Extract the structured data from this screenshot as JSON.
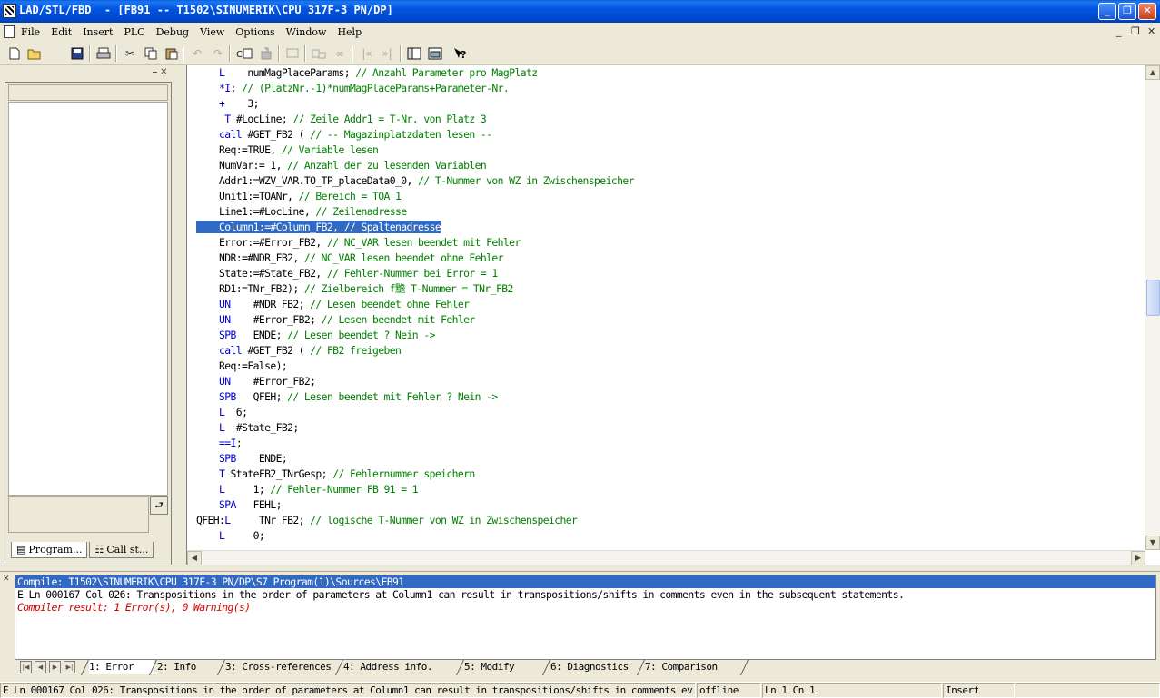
{
  "window": {
    "title": "LAD/STL/FBD  - [FB91 -- T1502\\SINUMERIK\\CPU 317F-3 PN/DP]",
    "controls": {
      "minimize": "_",
      "restore": "❐",
      "close": "✕"
    }
  },
  "menu": {
    "items": [
      "File",
      "Edit",
      "Insert",
      "PLC",
      "Debug",
      "View",
      "Options",
      "Window",
      "Help"
    ],
    "mdi_minimize": "_",
    "mdi_restore": "❐",
    "mdi_close": "✕"
  },
  "toolbar": {
    "icons": [
      "new-icon",
      "open-icon",
      "save-icon",
      "print-icon",
      "cut-icon",
      "copy-icon",
      "paste-icon",
      "undo-icon",
      "redo-icon",
      "compile-icon",
      "download-icon",
      "monitor-icon",
      "breakpoint-icon",
      "step-icon",
      "prev-error-icon",
      "next-error-icon",
      "overview-icon",
      "details-icon",
      "help-context-icon"
    ]
  },
  "left_panel": {
    "tabs": [
      {
        "label": "Program..."
      },
      {
        "label": "Call st..."
      }
    ]
  },
  "editor": {
    "lines": [
      {
        "prefix": "",
        "parts": [
          {
            "t": "    "
          },
          {
            "t": "L",
            "c": "kw"
          },
          {
            "t": "    numMagPlaceParams; "
          },
          {
            "t": "// Anzahl Parameter pro MagPlatz",
            "c": "cm"
          }
        ]
      },
      {
        "prefix": "",
        "parts": [
          {
            "t": "    "
          },
          {
            "t": "*I",
            "c": "kw"
          },
          {
            "t": "; "
          },
          {
            "t": "// (PlatzNr.-1)*numMagPlaceParams+Parameter-Nr.",
            "c": "cm"
          }
        ]
      },
      {
        "prefix": "",
        "parts": [
          {
            "t": "    "
          },
          {
            "t": "+",
            "c": "kw"
          },
          {
            "t": "    3;"
          }
        ]
      },
      {
        "prefix": "",
        "parts": [
          {
            "t": "     "
          },
          {
            "t": "T",
            "c": "kw"
          },
          {
            "t": " #LocLine; "
          },
          {
            "t": "// Zeile Addr1 = T-Nr. von Platz 3",
            "c": "cm"
          }
        ]
      },
      {
        "prefix": "",
        "parts": [
          {
            "t": "    "
          },
          {
            "t": "call",
            "c": "kw"
          },
          {
            "t": " #GET_FB2 ( "
          },
          {
            "t": "// -- Magazinplatzdaten lesen --",
            "c": "cm"
          }
        ]
      },
      {
        "prefix": "",
        "parts": [
          {
            "t": "    Req:=TRUE, "
          },
          {
            "t": "// Variable lesen",
            "c": "cm"
          }
        ]
      },
      {
        "prefix": "",
        "parts": [
          {
            "t": "    NumVar:= 1, "
          },
          {
            "t": "// Anzahl der zu lesenden Variablen",
            "c": "cm"
          }
        ]
      },
      {
        "prefix": "",
        "parts": [
          {
            "t": "    Addr1:=WZV_VAR.TO_TP_placeData0_0, "
          },
          {
            "t": "// T-Nummer von WZ in Zwischenspeicher",
            "c": "cm"
          }
        ]
      },
      {
        "prefix": "",
        "parts": [
          {
            "t": "    Unit1:=TOANr, "
          },
          {
            "t": "// Bereich = TOA 1",
            "c": "cm"
          }
        ]
      },
      {
        "prefix": "",
        "parts": [
          {
            "t": "    Line1:=#LocLine, "
          },
          {
            "t": "// Zeilenadresse",
            "c": "cm"
          }
        ]
      },
      {
        "prefix": "",
        "parts": [
          {
            "t": "    Column1:=#Column_FB2, // Spaltenadresse",
            "c": "hl"
          }
        ]
      },
      {
        "prefix": "",
        "parts": [
          {
            "t": "    Error:=#Error_FB2, "
          },
          {
            "t": "// NC_VAR lesen beendet mit Fehler",
            "c": "cm"
          }
        ]
      },
      {
        "prefix": "",
        "parts": [
          {
            "t": "    NDR:=#NDR_FB2, "
          },
          {
            "t": "// NC_VAR lesen beendet ohne Fehler",
            "c": "cm"
          }
        ]
      },
      {
        "prefix": "",
        "parts": [
          {
            "t": "    State:=#State_FB2, "
          },
          {
            "t": "// Fehler-Nummer bei Error = 1",
            "c": "cm"
          }
        ]
      },
      {
        "prefix": "",
        "parts": [
          {
            "t": "    RD1:=TNr_FB2); "
          },
          {
            "t": "// Zielbereich f黵 T-Nummer = TNr_FB2",
            "c": "cm"
          }
        ]
      },
      {
        "prefix": "",
        "parts": [
          {
            "t": "    "
          },
          {
            "t": "UN",
            "c": "kw"
          },
          {
            "t": "    #NDR_FB2; "
          },
          {
            "t": "// Lesen beendet ohne Fehler",
            "c": "cm"
          }
        ]
      },
      {
        "prefix": "",
        "parts": [
          {
            "t": "    "
          },
          {
            "t": "UN",
            "c": "kw"
          },
          {
            "t": "    #Error_FB2; "
          },
          {
            "t": "// Lesen beendet mit Fehler",
            "c": "cm"
          }
        ]
      },
      {
        "prefix": "",
        "parts": [
          {
            "t": "    "
          },
          {
            "t": "SPB",
            "c": "kw"
          },
          {
            "t": "   ENDE; "
          },
          {
            "t": "// Lesen beendet ? Nein ->",
            "c": "cm"
          }
        ]
      },
      {
        "prefix": "",
        "parts": [
          {
            "t": "    "
          },
          {
            "t": "call",
            "c": "kw"
          },
          {
            "t": " #GET_FB2 ( "
          },
          {
            "t": "// FB2 freigeben",
            "c": "cm"
          }
        ]
      },
      {
        "prefix": "",
        "parts": [
          {
            "t": "    Req:=False);"
          }
        ]
      },
      {
        "prefix": "",
        "parts": [
          {
            "t": "    "
          },
          {
            "t": "UN",
            "c": "kw"
          },
          {
            "t": "    #Error_FB2;"
          }
        ]
      },
      {
        "prefix": "",
        "parts": [
          {
            "t": "    "
          },
          {
            "t": "SPB",
            "c": "kw"
          },
          {
            "t": "   QFEH; "
          },
          {
            "t": "// Lesen beendet mit Fehler ? Nein ->",
            "c": "cm"
          }
        ]
      },
      {
        "prefix": "",
        "parts": [
          {
            "t": "    "
          },
          {
            "t": "L",
            "c": "kw"
          },
          {
            "t": "  6;"
          }
        ]
      },
      {
        "prefix": "",
        "parts": [
          {
            "t": "    "
          },
          {
            "t": "L",
            "c": "kw"
          },
          {
            "t": "  #State_FB2;"
          }
        ]
      },
      {
        "prefix": "",
        "parts": [
          {
            "t": "    "
          },
          {
            "t": "==I",
            "c": "kw"
          },
          {
            "t": ";"
          }
        ]
      },
      {
        "prefix": "",
        "parts": [
          {
            "t": "    "
          },
          {
            "t": "SPB",
            "c": "kw"
          },
          {
            "t": "    ENDE;"
          }
        ]
      },
      {
        "prefix": "",
        "parts": [
          {
            "t": "    "
          },
          {
            "t": "T",
            "c": "kw"
          },
          {
            "t": " StateFB2_TNrGesp; "
          },
          {
            "t": "// Fehlernummer speichern",
            "c": "cm"
          }
        ]
      },
      {
        "prefix": "",
        "parts": [
          {
            "t": "    "
          },
          {
            "t": "L",
            "c": "kw"
          },
          {
            "t": "     1; "
          },
          {
            "t": "// Fehler-Nummer FB 91 = 1",
            "c": "cm"
          }
        ]
      },
      {
        "prefix": "",
        "parts": [
          {
            "t": "    "
          },
          {
            "t": "SPA",
            "c": "kw"
          },
          {
            "t": "   FEHL;"
          }
        ]
      },
      {
        "prefix": "",
        "parts": [
          {
            "t": "QFEH:"
          },
          {
            "t": "L",
            "c": "kw"
          },
          {
            "t": "     TNr_FB2; "
          },
          {
            "t": "// logische T-Nummer von WZ in Zwischenspeicher",
            "c": "cm"
          }
        ]
      },
      {
        "prefix": "",
        "parts": [
          {
            "t": "    "
          },
          {
            "t": "L",
            "c": "kw"
          },
          {
            "t": "     0;"
          }
        ]
      }
    ]
  },
  "output": {
    "lines": [
      {
        "text": "Compile: T1502\\SINUMERIK\\CPU 317F-3 PN/DP\\S7 Program(1)\\Sources\\FB91",
        "style": "sel"
      },
      {
        "text": "E Ln 000167 Col 026: Transpositions in the order of parameters at Column1 can result in transpositions/shifts in comments even in the subsequent statements.",
        "style": ""
      },
      {
        "text": "Compiler result: 1 Error(s), 0 Warning(s)",
        "style": "err"
      }
    ],
    "tabs": [
      "1: Error",
      "2: Info",
      "3: Cross-references",
      "4: Address info.",
      "5: Modify",
      "6: Diagnostics",
      "7: Comparison"
    ]
  },
  "status": {
    "message": "E Ln 000167 Col 026: Transpositions in the order of parameters at Column1 can result in transpositions/shifts in comments ev...",
    "mode": "offline",
    "position": "Ln 1 Cn 1",
    "insert": "Insert"
  }
}
